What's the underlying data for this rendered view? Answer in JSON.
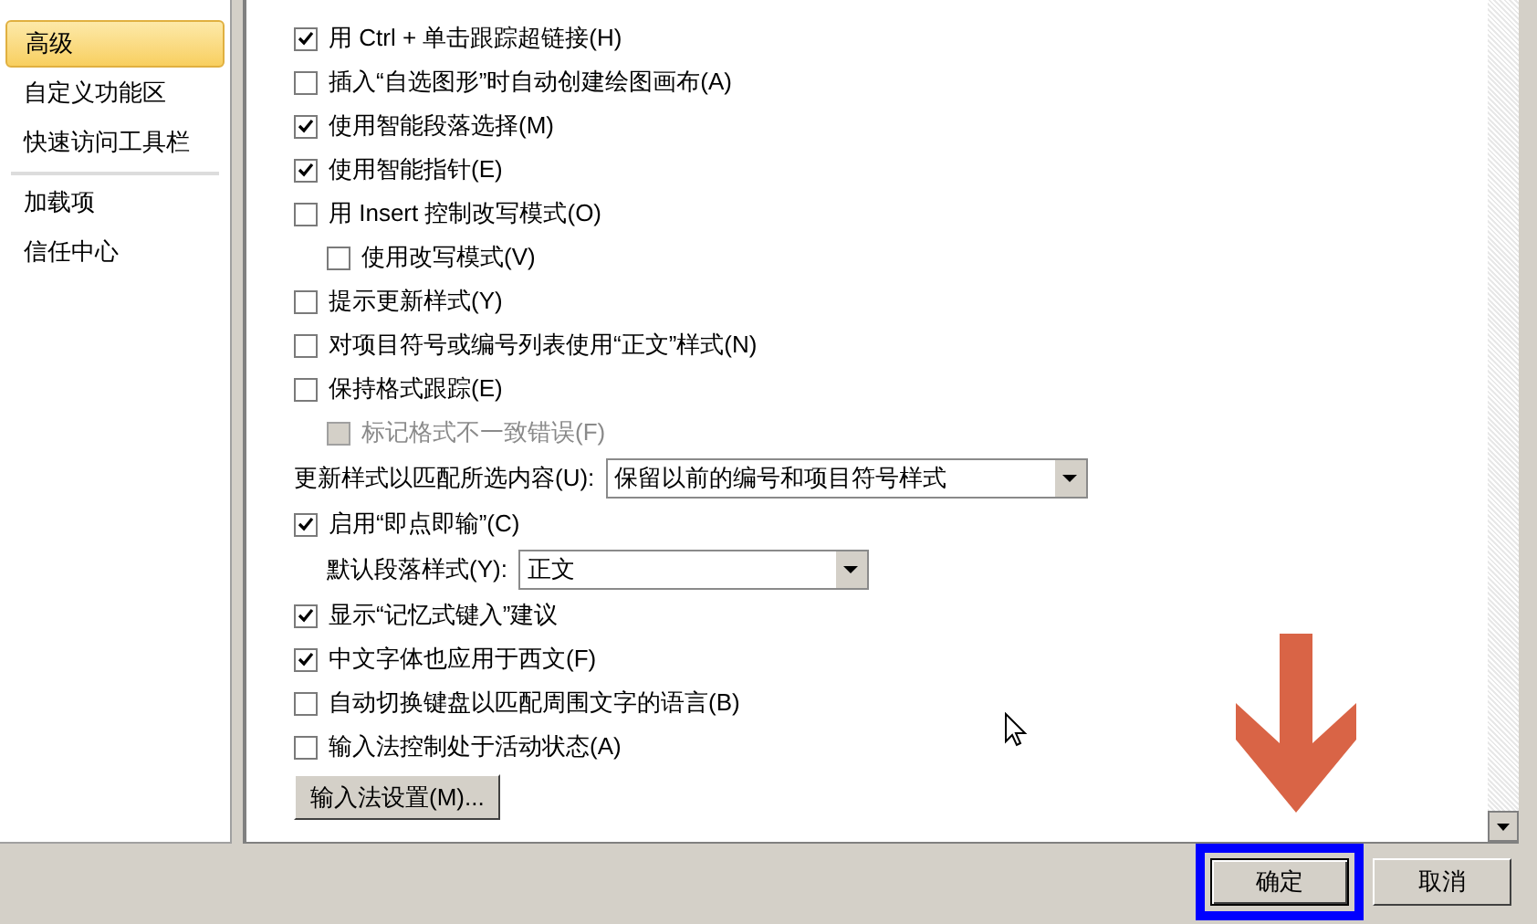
{
  "sidebar": {
    "items": [
      {
        "label": "高级",
        "selected": true
      },
      {
        "label": "自定义功能区",
        "selected": false
      },
      {
        "label": "快速访问工具栏",
        "selected": false,
        "divider_after": true
      },
      {
        "label": "加载项",
        "selected": false
      },
      {
        "label": "信任中心",
        "selected": false
      }
    ]
  },
  "options": [
    {
      "kind": "checkbox",
      "label": "用 Ctrl + 单击跟踪超链接(H)",
      "checked": true,
      "disabled": false
    },
    {
      "kind": "checkbox",
      "label": "插入“自选图形”时自动创建绘图画布(A)",
      "checked": false,
      "disabled": false
    },
    {
      "kind": "checkbox",
      "label": "使用智能段落选择(M)",
      "checked": true,
      "disabled": false
    },
    {
      "kind": "checkbox",
      "label": "使用智能指针(E)",
      "checked": true,
      "disabled": false
    },
    {
      "kind": "checkbox",
      "label": "用 Insert 控制改写模式(O)",
      "checked": false,
      "disabled": false,
      "children": [
        {
          "kind": "checkbox",
          "label": "使用改写模式(V)",
          "checked": false,
          "disabled": false
        }
      ]
    },
    {
      "kind": "checkbox",
      "label": "提示更新样式(Y)",
      "checked": false,
      "disabled": false
    },
    {
      "kind": "checkbox",
      "label": "对项目符号或编号列表使用“正文”样式(N)",
      "checked": false,
      "disabled": false
    },
    {
      "kind": "checkbox",
      "label": "保持格式跟踪(E)",
      "checked": false,
      "disabled": false,
      "children": [
        {
          "kind": "checkbox",
          "label": "标记格式不一致错误(F)",
          "checked": false,
          "disabled": true
        }
      ]
    },
    {
      "kind": "dropdown",
      "label": "更新样式以匹配所选内容(U):",
      "value": "保留以前的编号和项目符号样式"
    },
    {
      "kind": "checkbox",
      "label": "启用“即点即输”(C)",
      "checked": true,
      "disabled": false,
      "children": [
        {
          "kind": "dropdown",
          "label": "默认段落样式(Y):",
          "value": "正文"
        }
      ]
    },
    {
      "kind": "checkbox",
      "label": "显示“记忆式键入”建议",
      "checked": true,
      "disabled": false
    },
    {
      "kind": "checkbox",
      "label": "中文字体也应用于西文(F)",
      "checked": true,
      "disabled": false
    },
    {
      "kind": "checkbox",
      "label": "自动切换键盘以匹配周围文字的语言(B)",
      "checked": false,
      "disabled": false
    },
    {
      "kind": "checkbox",
      "label": "输入法控制处于活动状态(A)",
      "checked": false,
      "disabled": false
    },
    {
      "kind": "button",
      "label": "输入法设置(M)..."
    }
  ],
  "footer": {
    "buttons": [
      {
        "label": "确定",
        "highlighted": true
      },
      {
        "label": "取消",
        "highlighted": false
      }
    ]
  }
}
